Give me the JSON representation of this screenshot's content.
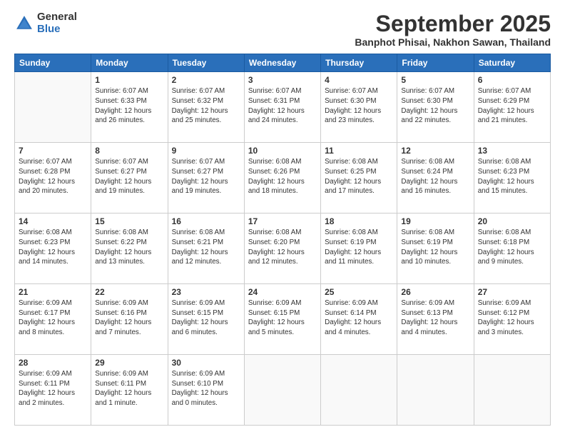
{
  "logo": {
    "general": "General",
    "blue": "Blue"
  },
  "title": "September 2025",
  "subtitle": "Banphot Phisai, Nakhon Sawan, Thailand",
  "days": [
    "Sunday",
    "Monday",
    "Tuesday",
    "Wednesday",
    "Thursday",
    "Friday",
    "Saturday"
  ],
  "weeks": [
    [
      {
        "num": "",
        "detail": ""
      },
      {
        "num": "1",
        "detail": "Sunrise: 6:07 AM\nSunset: 6:33 PM\nDaylight: 12 hours\nand 26 minutes."
      },
      {
        "num": "2",
        "detail": "Sunrise: 6:07 AM\nSunset: 6:32 PM\nDaylight: 12 hours\nand 25 minutes."
      },
      {
        "num": "3",
        "detail": "Sunrise: 6:07 AM\nSunset: 6:31 PM\nDaylight: 12 hours\nand 24 minutes."
      },
      {
        "num": "4",
        "detail": "Sunrise: 6:07 AM\nSunset: 6:30 PM\nDaylight: 12 hours\nand 23 minutes."
      },
      {
        "num": "5",
        "detail": "Sunrise: 6:07 AM\nSunset: 6:30 PM\nDaylight: 12 hours\nand 22 minutes."
      },
      {
        "num": "6",
        "detail": "Sunrise: 6:07 AM\nSunset: 6:29 PM\nDaylight: 12 hours\nand 21 minutes."
      }
    ],
    [
      {
        "num": "7",
        "detail": "Sunrise: 6:07 AM\nSunset: 6:28 PM\nDaylight: 12 hours\nand 20 minutes."
      },
      {
        "num": "8",
        "detail": "Sunrise: 6:07 AM\nSunset: 6:27 PM\nDaylight: 12 hours\nand 19 minutes."
      },
      {
        "num": "9",
        "detail": "Sunrise: 6:07 AM\nSunset: 6:27 PM\nDaylight: 12 hours\nand 19 minutes."
      },
      {
        "num": "10",
        "detail": "Sunrise: 6:08 AM\nSunset: 6:26 PM\nDaylight: 12 hours\nand 18 minutes."
      },
      {
        "num": "11",
        "detail": "Sunrise: 6:08 AM\nSunset: 6:25 PM\nDaylight: 12 hours\nand 17 minutes."
      },
      {
        "num": "12",
        "detail": "Sunrise: 6:08 AM\nSunset: 6:24 PM\nDaylight: 12 hours\nand 16 minutes."
      },
      {
        "num": "13",
        "detail": "Sunrise: 6:08 AM\nSunset: 6:23 PM\nDaylight: 12 hours\nand 15 minutes."
      }
    ],
    [
      {
        "num": "14",
        "detail": "Sunrise: 6:08 AM\nSunset: 6:23 PM\nDaylight: 12 hours\nand 14 minutes."
      },
      {
        "num": "15",
        "detail": "Sunrise: 6:08 AM\nSunset: 6:22 PM\nDaylight: 12 hours\nand 13 minutes."
      },
      {
        "num": "16",
        "detail": "Sunrise: 6:08 AM\nSunset: 6:21 PM\nDaylight: 12 hours\nand 12 minutes."
      },
      {
        "num": "17",
        "detail": "Sunrise: 6:08 AM\nSunset: 6:20 PM\nDaylight: 12 hours\nand 12 minutes."
      },
      {
        "num": "18",
        "detail": "Sunrise: 6:08 AM\nSunset: 6:19 PM\nDaylight: 12 hours\nand 11 minutes."
      },
      {
        "num": "19",
        "detail": "Sunrise: 6:08 AM\nSunset: 6:19 PM\nDaylight: 12 hours\nand 10 minutes."
      },
      {
        "num": "20",
        "detail": "Sunrise: 6:08 AM\nSunset: 6:18 PM\nDaylight: 12 hours\nand 9 minutes."
      }
    ],
    [
      {
        "num": "21",
        "detail": "Sunrise: 6:09 AM\nSunset: 6:17 PM\nDaylight: 12 hours\nand 8 minutes."
      },
      {
        "num": "22",
        "detail": "Sunrise: 6:09 AM\nSunset: 6:16 PM\nDaylight: 12 hours\nand 7 minutes."
      },
      {
        "num": "23",
        "detail": "Sunrise: 6:09 AM\nSunset: 6:15 PM\nDaylight: 12 hours\nand 6 minutes."
      },
      {
        "num": "24",
        "detail": "Sunrise: 6:09 AM\nSunset: 6:15 PM\nDaylight: 12 hours\nand 5 minutes."
      },
      {
        "num": "25",
        "detail": "Sunrise: 6:09 AM\nSunset: 6:14 PM\nDaylight: 12 hours\nand 4 minutes."
      },
      {
        "num": "26",
        "detail": "Sunrise: 6:09 AM\nSunset: 6:13 PM\nDaylight: 12 hours\nand 4 minutes."
      },
      {
        "num": "27",
        "detail": "Sunrise: 6:09 AM\nSunset: 6:12 PM\nDaylight: 12 hours\nand 3 minutes."
      }
    ],
    [
      {
        "num": "28",
        "detail": "Sunrise: 6:09 AM\nSunset: 6:11 PM\nDaylight: 12 hours\nand 2 minutes."
      },
      {
        "num": "29",
        "detail": "Sunrise: 6:09 AM\nSunset: 6:11 PM\nDaylight: 12 hours\nand 1 minute."
      },
      {
        "num": "30",
        "detail": "Sunrise: 6:09 AM\nSunset: 6:10 PM\nDaylight: 12 hours\nand 0 minutes."
      },
      {
        "num": "",
        "detail": ""
      },
      {
        "num": "",
        "detail": ""
      },
      {
        "num": "",
        "detail": ""
      },
      {
        "num": "",
        "detail": ""
      }
    ]
  ]
}
